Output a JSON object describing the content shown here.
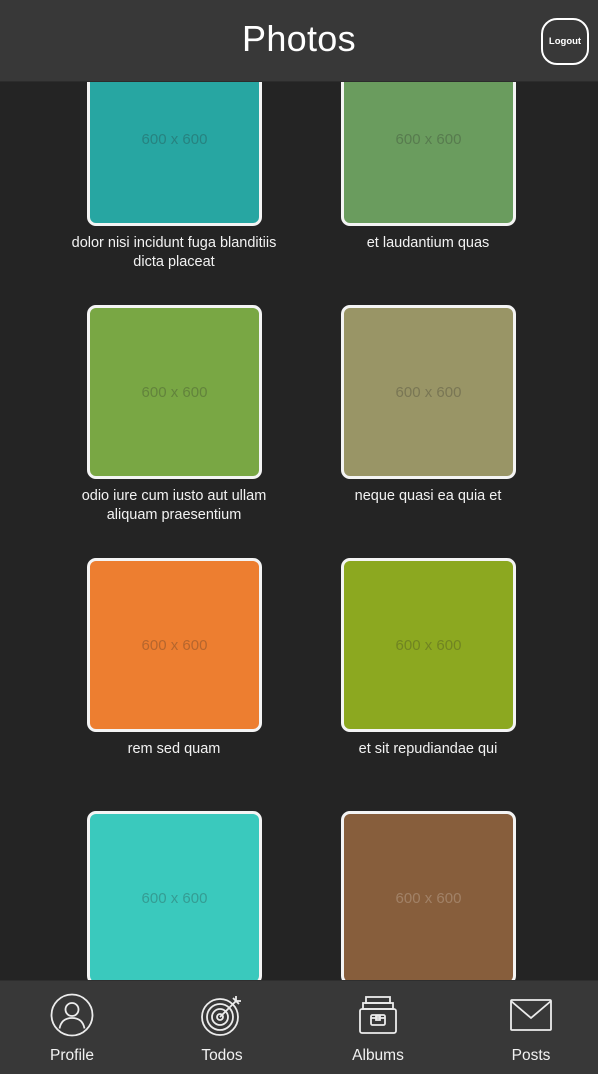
{
  "header": {
    "title": "Photos",
    "logout_label": "Logout"
  },
  "photos": [
    {
      "caption": "dolor nisi incidunt fuga blanditiis dicta placeat",
      "dimensions": "600 x 600",
      "color": "#27a6a2"
    },
    {
      "caption": "et laudantium quas",
      "dimensions": "600 x 600",
      "color": "#6a9c5e"
    },
    {
      "caption": "odio iure cum iusto aut ullam aliquam praesentium",
      "dimensions": "600 x 600",
      "color": "#79a744"
    },
    {
      "caption": "neque quasi ea quia et",
      "dimensions": "600 x 600",
      "color": "#999566"
    },
    {
      "caption": "rem sed quam",
      "dimensions": "600 x 600",
      "color": "#ed7e30"
    },
    {
      "caption": "et sit repudiandae qui",
      "dimensions": "600 x 600",
      "color": "#8ca820"
    },
    {
      "caption": "",
      "dimensions": "600 x 600",
      "color": "#3ac9bd"
    },
    {
      "caption": "",
      "dimensions": "600 x 600",
      "color": "#875e3c"
    }
  ],
  "tabbar": {
    "items": [
      {
        "label": "Profile",
        "icon": "profile-icon"
      },
      {
        "label": "Todos",
        "icon": "target-icon"
      },
      {
        "label": "Albums",
        "icon": "albums-icon"
      },
      {
        "label": "Posts",
        "icon": "envelope-icon"
      }
    ]
  }
}
